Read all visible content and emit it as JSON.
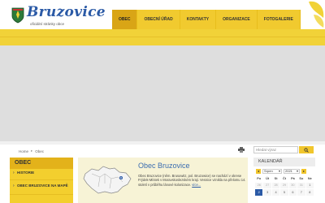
{
  "header": {
    "logo_title": "Bruzovice",
    "logo_subtitle": "oficiální stránky obce"
  },
  "nav": {
    "items": [
      {
        "label": "OBEC",
        "active": true
      },
      {
        "label": "OBECNÍ ÚŘAD",
        "active": false
      },
      {
        "label": "KONTAKTY",
        "active": false
      },
      {
        "label": "ORGANIZACE",
        "active": false
      },
      {
        "label": "FOTOGALERIE",
        "active": false
      }
    ]
  },
  "breadcrumb": {
    "home": "Home",
    "separator": "▸",
    "current": "Obec"
  },
  "search": {
    "placeholder": "Hledat výraz"
  },
  "sidebar": {
    "heading": "OBEC",
    "items": [
      {
        "label": "HISTORIE"
      },
      {
        "label": "OBEC BRUZOVICE NA MAPĚ"
      }
    ]
  },
  "main": {
    "title": "Obec Bruzovice",
    "text": "Obec Bruzovice (něm. Brusowitz, pol. Bruzowice) se nachází v okrese Frýdek-Místek v Moravskoslezském kraji. Vesnice vznikla na přelomu 14. století v průběhu lánové kolonizace.",
    "more_label": "více..."
  },
  "calendar": {
    "heading": "KALENDÁŘ",
    "month": "Srpen",
    "year": "2021",
    "weekdays": [
      "Po",
      "Út",
      "St",
      "Čt",
      "Pá",
      "So",
      "Ne"
    ],
    "days": [
      {
        "d": "26",
        "other": true
      },
      {
        "d": "27",
        "other": true
      },
      {
        "d": "28",
        "other": true
      },
      {
        "d": "29",
        "other": true
      },
      {
        "d": "30",
        "other": true
      },
      {
        "d": "31",
        "other": true
      },
      {
        "d": "1",
        "other": false
      },
      {
        "d": "2",
        "other": false,
        "today": true
      },
      {
        "d": "3",
        "other": false
      },
      {
        "d": "4",
        "other": false
      },
      {
        "d": "5",
        "other": false
      },
      {
        "d": "6",
        "other": false
      },
      {
        "d": "7",
        "other": false
      },
      {
        "d": "8",
        "other": false
      }
    ]
  },
  "colors": {
    "brand_yellow": "#f1ca2f",
    "brand_blue": "#2b5aa6",
    "active_nav": "#d9a516"
  }
}
